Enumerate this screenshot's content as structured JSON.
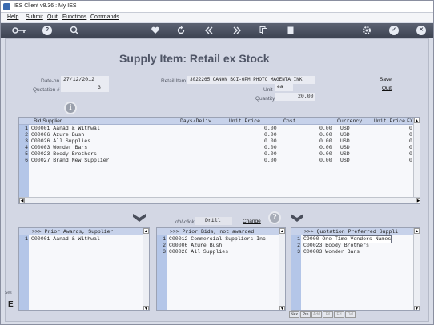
{
  "window": {
    "title": "IES Client v8.36 : My IES"
  },
  "menu": {
    "items": [
      "Help",
      "Submit",
      "Quit",
      "Functions",
      "Commands"
    ]
  },
  "toolbar": {
    "icons": [
      "key-icon",
      "help-icon",
      "search-icon",
      "heart-icon",
      "refresh-icon",
      "rewind-icon",
      "forward-icon",
      "copy-icon",
      "page-icon",
      "settings-icon",
      "check-icon",
      "close-icon"
    ],
    "help_glyph": "?",
    "check_glyph": "✓",
    "close_glyph": "✕"
  },
  "page": {
    "title": "Supply Item: Retail ex Stock"
  },
  "form": {
    "date_on_label": "Date-on",
    "date_on_value": "27/12/2012",
    "quotation_label": "Quotation #",
    "quotation_value": "3",
    "retail_item_label": "Retail Item",
    "retail_item_value": "3022265 CANON BCI-6PM PHOTO MAGENTA INK",
    "unit_label": "Unit",
    "unit_value": "ea",
    "quantity_label": "Quantity",
    "quantity_value": "20.00",
    "save_label": "Save",
    "quit_label": "Quit"
  },
  "info_glyph": "i",
  "bids_table": {
    "columns": [
      "Bid Supplier",
      "Days/Deliv",
      "Unit Price",
      "Cost",
      "Currency",
      "Unit Price",
      "FX"
    ],
    "rows": [
      {
        "n": "1",
        "supplier": "C00001 Aanad & Withwal",
        "unit_price": "0.00",
        "cost": "0.00",
        "currency": "USD",
        "fx": "0"
      },
      {
        "n": "2",
        "supplier": "C00006 Azure Bush",
        "unit_price": "0.00",
        "cost": "0.00",
        "currency": "USD",
        "fx": "0"
      },
      {
        "n": "3",
        "supplier": "C00026 All Supplies",
        "unit_price": "0.00",
        "cost": "0.00",
        "currency": "USD",
        "fx": "0"
      },
      {
        "n": "4",
        "supplier": "C00003 Wonder Bars",
        "unit_price": "0.00",
        "cost": "0.00",
        "currency": "USD",
        "fx": "0"
      },
      {
        "n": "5",
        "supplier": "C00023 Boody Brothers",
        "unit_price": "0.00",
        "cost": "0.00",
        "currency": "USD",
        "fx": "0"
      },
      {
        "n": "6",
        "supplier": "C00027 Brand New Supplier",
        "unit_price": "0.00",
        "cost": "0.00",
        "currency": "USD",
        "fx": "0"
      }
    ]
  },
  "toggle": {
    "label": "dbl-click Toggle",
    "value": "Drill",
    "change_label": "Change",
    "help_glyph": "?"
  },
  "prior_awards": {
    "header": ">>> Prior Awards, Supplier",
    "rows": [
      {
        "n": "1",
        "text": "C00001 Aanad & Withwal"
      }
    ]
  },
  "prior_bids": {
    "header": ">>> Prior Bids, not awarded",
    "rows": [
      {
        "n": "1",
        "text": "C00012 Commercial Suppliers Inc"
      },
      {
        "n": "2",
        "text": "C00006 Azure Bush"
      },
      {
        "n": "3",
        "text": "C00026 All Supplies"
      }
    ]
  },
  "preferred": {
    "header": ">>> Quotation Preferred Suppli",
    "rows": [
      {
        "n": "1",
        "text": "C9000 One Time Vendors Names"
      },
      {
        "n": "2",
        "text": "C00023 Boody Brothers"
      },
      {
        "n": "3",
        "text": "C00003 Wonder Bars"
      }
    ]
  },
  "bottom_tabs": [
    "Nex",
    "Pre",
    "Add",
    "Fil",
    "Ed",
    "Del"
  ],
  "left_edge": {
    "text": "Ses",
    "letter": "E"
  },
  "colors": {
    "toolbar": "#4a5060",
    "header": "#c7d2ea",
    "row_strip": "#b4c6e8",
    "title": "#4f5566"
  }
}
